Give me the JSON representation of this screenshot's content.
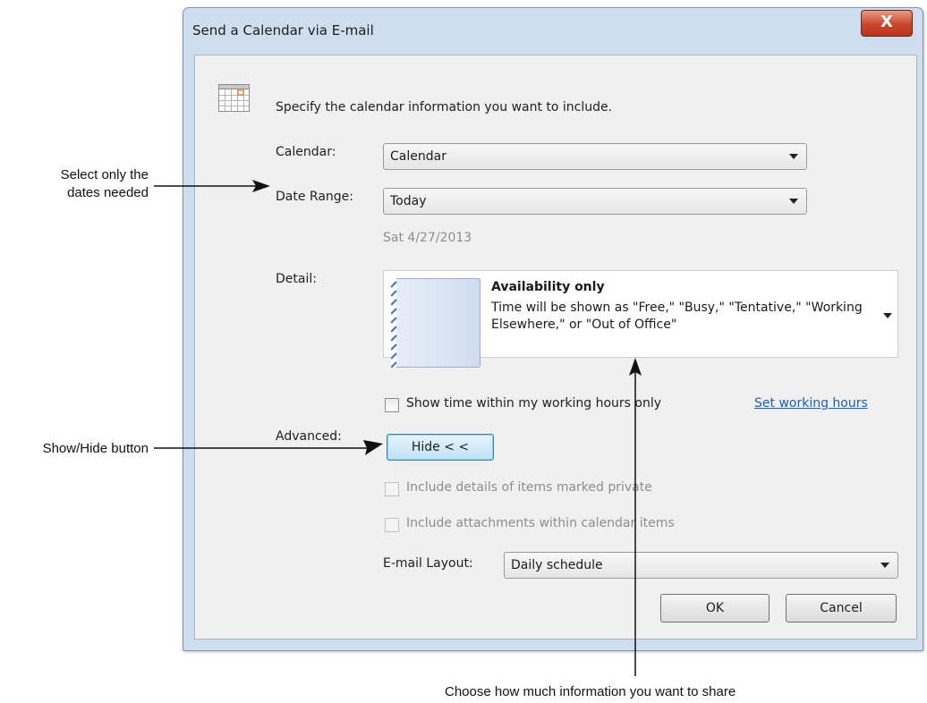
{
  "window": {
    "title": "Send a Calendar via E-mail",
    "close_glyph": "X"
  },
  "intro_text": "Specify the calendar information you want to include.",
  "calendar": {
    "label": "Calendar:",
    "value": "Calendar"
  },
  "date_range": {
    "label": "Date Range:",
    "value": "Today",
    "date_text": "Sat 4/27/2013"
  },
  "detail": {
    "label": "Detail:",
    "title": "Availability only",
    "description": "Time will be shown as \"Free,\" \"Busy,\" \"Tentative,\" \"Working Elsewhere,\" or \"Out of Office\""
  },
  "working_hours": {
    "checkbox_label": "Show time within my working hours only",
    "checked": false,
    "link_text": "Set working hours"
  },
  "advanced": {
    "label": "Advanced:",
    "button_label": "Hide < <",
    "private_label": "Include details of items marked private",
    "attachments_label": "Include attachments within calendar items"
  },
  "email_layout": {
    "label": "E-mail Layout:",
    "value": "Daily schedule"
  },
  "buttons": {
    "ok": "OK",
    "cancel": "Cancel"
  },
  "annotations": {
    "select_dates": [
      "Select only the",
      "dates needed"
    ],
    "show_hide": "Show/Hide button",
    "share_info": "Choose how much information you want to share"
  },
  "colors": {
    "link": "#1a5fb4",
    "close_button": "#c9462c",
    "hide_button": "#bfe1f7",
    "window_frame": "#cfdeee"
  },
  "icons": {
    "calendar": "calendar-icon",
    "close": "close-icon",
    "dropdown": "chevron-down-icon"
  }
}
